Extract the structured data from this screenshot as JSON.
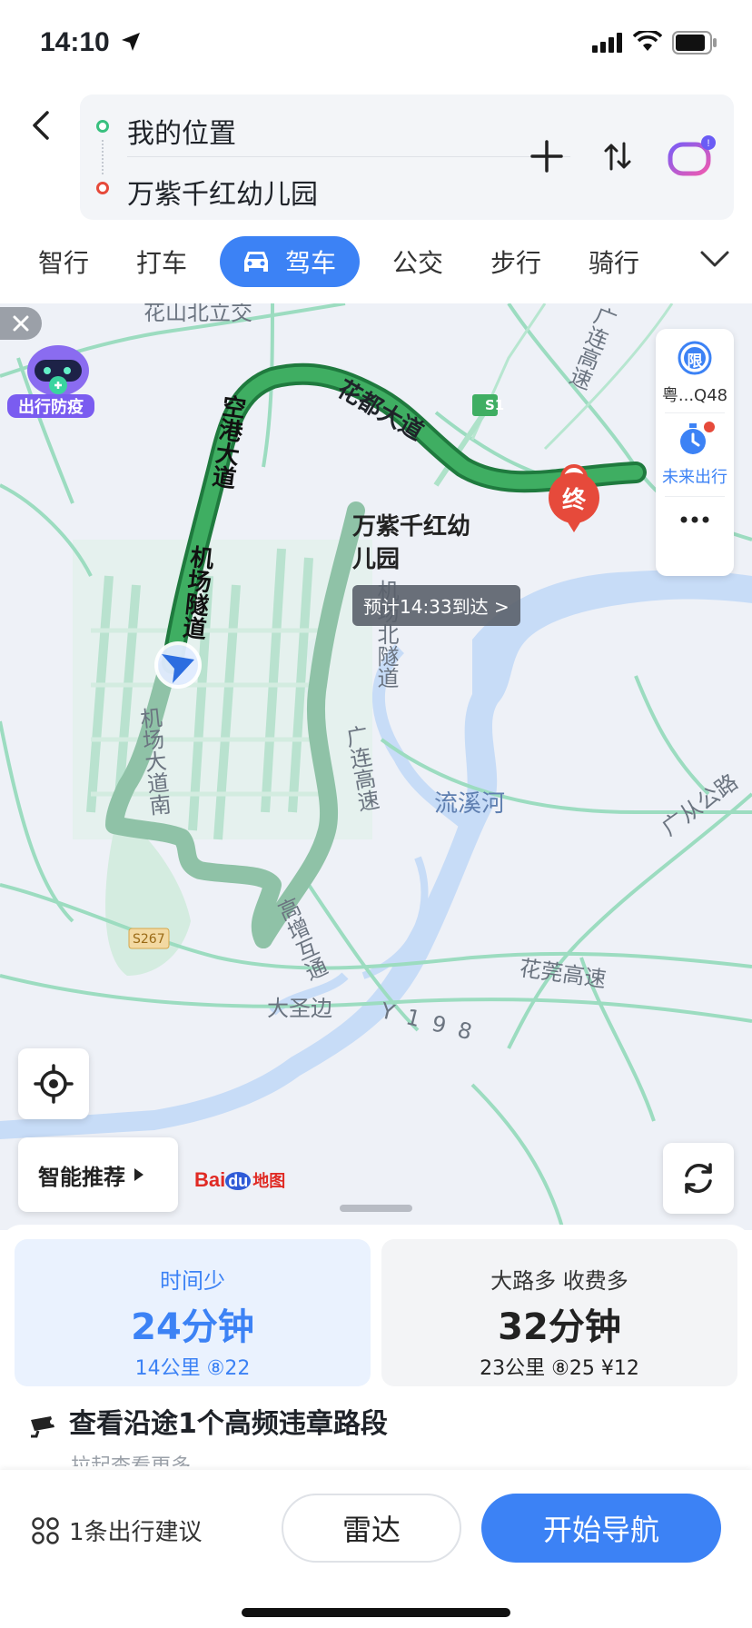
{
  "status_bar": {
    "time": "14:10"
  },
  "route": {
    "origin": "我的位置",
    "destination": "万紫千红幼儿园"
  },
  "tabs": [
    "智行",
    "打车",
    "驾车",
    "公交",
    "步行",
    "骑行"
  ],
  "active_tab": "驾车",
  "map": {
    "labels": {
      "huadu": "花都大道",
      "konggang": "空港大道",
      "jichang_tunnel": "机场隧道",
      "jichang_south": "机场大道南",
      "jichang_north": "机场北隧道",
      "guanglian_1": "广连高速",
      "guanglian_2": "广连高速",
      "gaozeng": "高增互通",
      "liuxi": "流溪河",
      "guangcong": "广从公路",
      "huaguan": "花莞高速",
      "dashengbian": "大圣边",
      "y198": "Y198",
      "s1": "S1",
      "s267": "S267",
      "huashan_fragment": "花山北立交"
    },
    "destination_label": "万紫千红幼儿园",
    "end_marker": "终",
    "eta_pill": "预计14:33到达 >",
    "epidemic_badge": "出行防疫",
    "restriction": {
      "icon_text": "限",
      "plate": "粤...Q48"
    },
    "future_trip": "未来出行",
    "smart_recommend": "智能推荐",
    "baidu_logo": {
      "bai": "Bai",
      "du": "du",
      "map": "地图"
    },
    "colors": {
      "route_main": "#3fae62",
      "route_alt": "#8fc2a7",
      "water": "#c7dcf7",
      "accent": "#3c82f5"
    }
  },
  "route_options": [
    {
      "tag": "时间少",
      "time": "24分钟",
      "meta": "14公里  ⑧22"
    },
    {
      "tag": "大路多  收费多",
      "time": "32分钟",
      "meta": "23公里  ⑧25  ¥12"
    }
  ],
  "violation": "查看沿途1个高频违章路段",
  "more_hint": "拉起查看更多",
  "bottom": {
    "advice": "1条出行建议",
    "radar": "雷达",
    "navigate": "开始导航"
  }
}
